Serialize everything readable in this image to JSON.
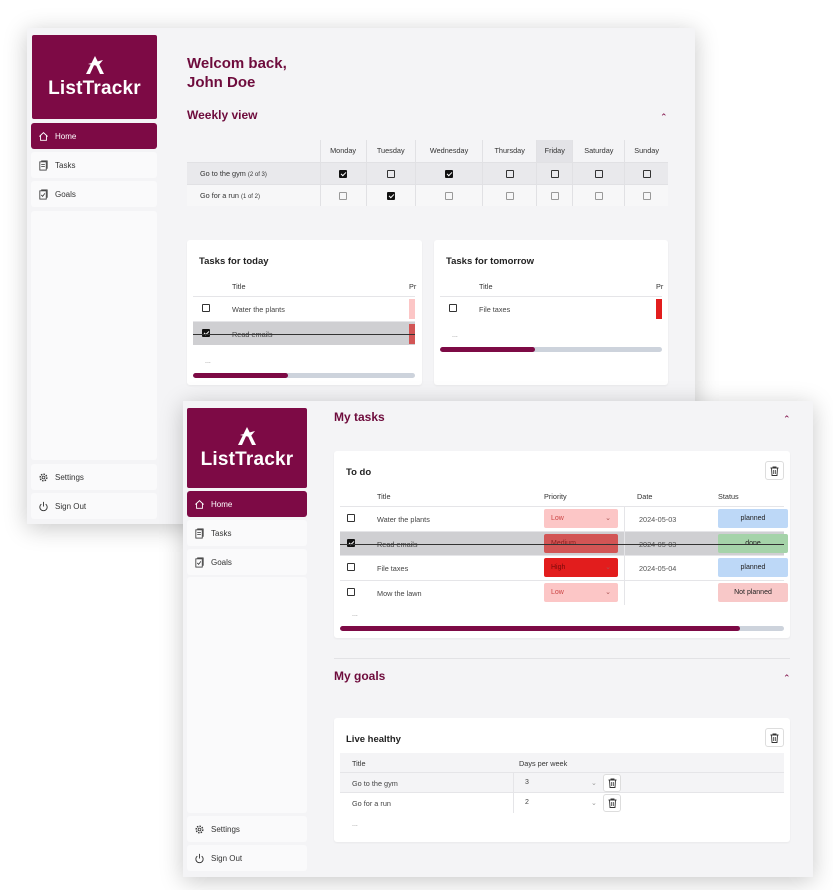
{
  "app": {
    "name": "ListTrackr"
  },
  "nav": {
    "home": "Home",
    "tasks": "Tasks",
    "goals": "Goals",
    "settings": "Settings",
    "sign_out": "Sign Out"
  },
  "greeting": {
    "line1": "Welcom back,",
    "line2": "John Doe"
  },
  "weekly": {
    "title": "Weekly view",
    "days": [
      "Monday",
      "Tuesday",
      "Wednesday",
      "Thursday",
      "Friday",
      "Saturday",
      "Sunday"
    ],
    "today": "Friday",
    "rows": [
      {
        "label": "Go to the gym",
        "count": "(2 of 3)",
        "checks": [
          true,
          false,
          true,
          false,
          false,
          false,
          false
        ]
      },
      {
        "label": "Go for a run",
        "count": "(1 of 2)",
        "checks": [
          false,
          true,
          false,
          false,
          false,
          false,
          false
        ]
      }
    ]
  },
  "today_card": {
    "title": "Tasks for today",
    "col_title": "Title",
    "col_prio": "Pr",
    "tasks": [
      {
        "title": "Water the plants",
        "done": false
      },
      {
        "title": "Read emails",
        "done": true
      }
    ],
    "more": "...",
    "progress": 0.43
  },
  "tomorrow_card": {
    "title": "Tasks for tomorrow",
    "col_title": "Title",
    "col_prio": "Pr",
    "tasks": [
      {
        "title": "File taxes",
        "done": false
      }
    ],
    "more": "...",
    "progress": 0.43
  },
  "my_tasks": {
    "title": "My tasks",
    "card_title": "To do",
    "columns": {
      "title": "Title",
      "priority": "Priority",
      "date": "Date",
      "status": "Status"
    },
    "rows": [
      {
        "title": "Water the plants",
        "done": false,
        "priority": "Low",
        "date": "2024-05-03",
        "status": "planned"
      },
      {
        "title": "Read emails",
        "done": true,
        "priority": "Medium",
        "date": "2024-05-03",
        "status": "done"
      },
      {
        "title": "File taxes",
        "done": false,
        "priority": "High",
        "date": "2024-05-04",
        "status": "planned"
      },
      {
        "title": "Mow the lawn",
        "done": false,
        "priority": "Low",
        "date": "",
        "status": "Not planned"
      }
    ],
    "more": "...",
    "progress": 0.9
  },
  "my_goals": {
    "title": "My goals",
    "card_title": "Live healthy",
    "columns": {
      "title": "Title",
      "days": "Days per week"
    },
    "rows": [
      {
        "title": "Go to the gym",
        "days": "3"
      },
      {
        "title": "Go for a run",
        "days": "2"
      }
    ],
    "more": "..."
  }
}
